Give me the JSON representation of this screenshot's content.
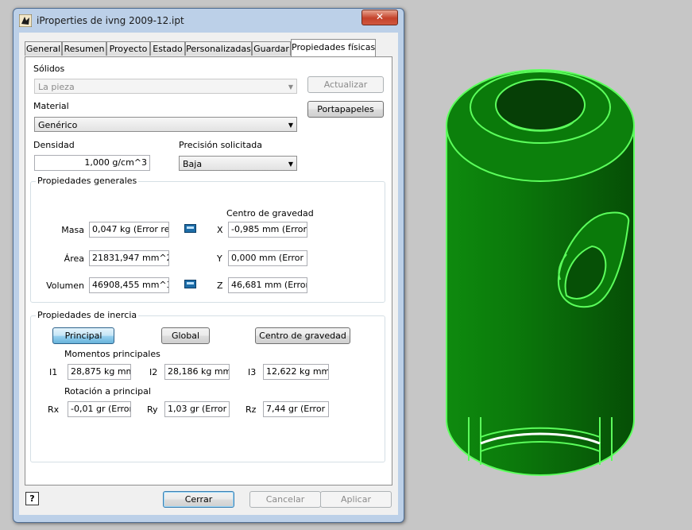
{
  "window": {
    "title": "iProperties de ivng 2009-12.ipt",
    "close_label": "✕"
  },
  "tabs": [
    "General",
    "Resumen",
    "Proyecto",
    "Estado",
    "Personalizadas",
    "Guardar",
    "Propiedades físicas"
  ],
  "solidos": {
    "label": "Sólidos",
    "value": "La pieza",
    "update_button": "Actualizar",
    "clipboard_button": "Portapapeles"
  },
  "material": {
    "label": "Material",
    "value": "Genérico"
  },
  "densidad": {
    "label": "Densidad",
    "value": "1,000 g/cm^3"
  },
  "precision": {
    "label": "Precisión solicitada",
    "value": "Baja"
  },
  "general_props": {
    "legend": "Propiedades generales",
    "masa_label": "Masa",
    "masa_value": "0,047 kg (Error rela",
    "area_label": "Área",
    "area_value": "21831,947 mm^2 (",
    "volumen_label": "Volumen",
    "volumen_value": "46908,455 mm^3 (",
    "cog_title": "Centro de gravedad",
    "x_label": "X",
    "x_value": "-0,985 mm (Error re",
    "y_label": "Y",
    "y_value": "0,000 mm (Error rel",
    "z_label": "Z",
    "z_value": "46,681 mm (Error r"
  },
  "inertia": {
    "legend": "Propiedades de inercia",
    "btn_principal": "Principal",
    "btn_global": "Global",
    "btn_cog": "Centro de gravedad",
    "moments_title": "Momentos principales",
    "i1_label": "I1",
    "i1_value": "28,875 kg mm^",
    "i2_label": "I2",
    "i2_value": "28,186 kg mm^",
    "i3_label": "I3",
    "i3_value": "12,622 kg mm^",
    "rotation_title": "Rotación a principal",
    "rx_label": "Rx",
    "rx_value": "-0,01 gr (Error r",
    "ry_label": "Ry",
    "ry_value": "1,03 gr (Error r",
    "rz_label": "Rz",
    "rz_value": "7,44 gr (Error r"
  },
  "footer": {
    "help": "?",
    "close_button": "Cerrar",
    "cancel_button": "Cancelar",
    "apply_button": "Aplicar"
  },
  "colors": {
    "part_fill": "#0a7a0a",
    "part_edge": "#5cff5c",
    "viewport_bg": "#c6c6c6"
  },
  "icons": [
    "app-icon",
    "close-icon",
    "calculator-icon",
    "help-icon",
    "dropdown-arrow-icon"
  ]
}
